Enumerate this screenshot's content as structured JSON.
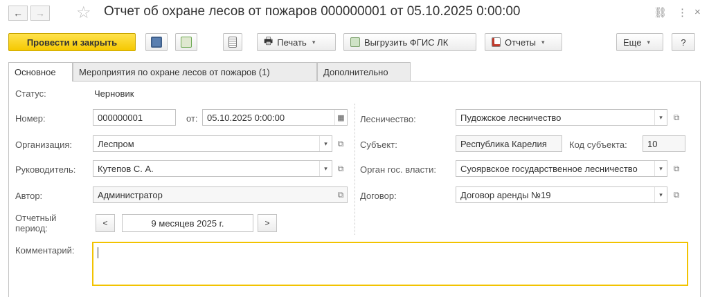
{
  "window": {
    "title": "Отчет об охране лесов от пожаров 000000001 от 05.10.2025 0:00:00",
    "back_icon": "arrow-left-icon",
    "forward_icon": "arrow-right-icon",
    "favorite_icon": "star-icon",
    "link_icon": "link-icon",
    "more_icon": "kebab-icon",
    "close_icon": "close-icon",
    "back_glyph": "←",
    "forward_glyph": "→",
    "star_glyph": "☆",
    "link_glyph": "⛓",
    "more_glyph": "⋮",
    "close_glyph": "×"
  },
  "toolbar": {
    "post_close": "Провести и закрыть",
    "print": "Печать",
    "export": "Выгрузить ФГИС ЛК",
    "reports": "Отчеты",
    "more": "Еще",
    "help": "?"
  },
  "tabs": [
    {
      "label": "Основное"
    },
    {
      "label": "Мероприятия по охране лесов от пожаров (1)"
    },
    {
      "label": "Дополнительно"
    }
  ],
  "form": {
    "status": {
      "label": "Статус:",
      "value": "Черновик"
    },
    "number": {
      "label": "Номер:",
      "value": "000000001"
    },
    "date": {
      "label": "от:",
      "value": "05.10.2025  0:00:00"
    },
    "organization": {
      "label": "Организация:",
      "value": "Леспром"
    },
    "head": {
      "label": "Руководитель:",
      "value": "Кутепов С. А."
    },
    "author": {
      "label": "Автор:",
      "value": "Администратор"
    },
    "period": {
      "label": "Отчетный период:",
      "value": "9 месяцев 2025 г.",
      "prev": "<",
      "next": ">"
    },
    "forestry": {
      "label": "Лесничество:",
      "value": "Пудожское лесничество"
    },
    "subject": {
      "label": "Субъект:",
      "value": "Республика Карелия"
    },
    "subject_code": {
      "label": "Код субъекта:",
      "value": "10"
    },
    "authority": {
      "label": "Орган гос. власти:",
      "value": "Суоярвское государственное лесничество"
    },
    "contract": {
      "label": "Договор:",
      "value": "Договор аренды №19"
    },
    "comment": {
      "label": "Комментарий:",
      "value": ""
    }
  },
  "colors": {
    "primary_button": "#f5c800",
    "comment_focus_border": "#f2c300"
  }
}
